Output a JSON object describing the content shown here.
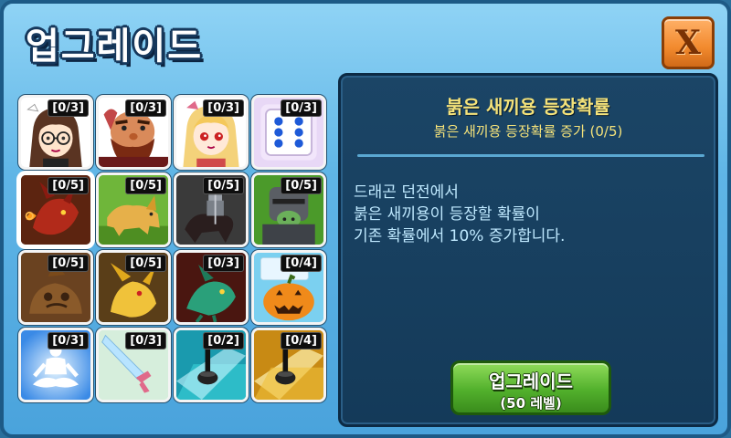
{
  "window": {
    "title": "업그레이드",
    "close_label": "X"
  },
  "upgrades": [
    {
      "name": "girl-glasses",
      "count": "[0/3]",
      "bg": "#ffffff"
    },
    {
      "name": "bearded-man",
      "count": "[0/3]",
      "bg": "#ffffff"
    },
    {
      "name": "blonde-girl",
      "count": "[0/3]",
      "bg": "#ffffff"
    },
    {
      "name": "dice",
      "count": "[0/3]",
      "bg": "#e8d8f6"
    },
    {
      "name": "red-dragon",
      "count": "[0/5]",
      "bg": "#6b2b12"
    },
    {
      "name": "golden-wolf",
      "count": "[0/5]",
      "bg": "#6fb63a"
    },
    {
      "name": "knight-rider",
      "count": "[0/5]",
      "bg": "#3b3b3b"
    },
    {
      "name": "orc-knight",
      "count": "[0/5]",
      "bg": "#4b9a2a"
    },
    {
      "name": "mud-blob",
      "count": "[0/5]",
      "bg": "#8b5a2a"
    },
    {
      "name": "golden-dragon",
      "count": "[0/5]",
      "bg": "#6a4a1c"
    },
    {
      "name": "green-dragon",
      "count": "[0/3]",
      "bg": "#5a1a14"
    },
    {
      "name": "pumpkin",
      "count": "[0/4]",
      "bg": "#7bd0f0"
    },
    {
      "name": "meditation",
      "count": "[0/3]",
      "bg": "#58a9f2"
    },
    {
      "name": "crystal-sword",
      "count": "[0/3]",
      "bg": "#c7e8c0"
    },
    {
      "name": "cyan-lamp",
      "count": "[0/2]",
      "bg": "#2bb8c8"
    },
    {
      "name": "gold-lamp",
      "count": "[0/4]",
      "bg": "#e0a81c"
    }
  ],
  "detail": {
    "title": "붉은 새끼용 등장확률",
    "subtitle": "붉은 새끼용 등장확률 증가 (0/5)",
    "description_lines": [
      "드래곤 던전에서",
      "붉은 새끼용이 등장할 확률이",
      "기존 확률에서 10% 증가합니다."
    ],
    "button_label": "업그레이드",
    "button_sub": "(50 레벨)"
  }
}
